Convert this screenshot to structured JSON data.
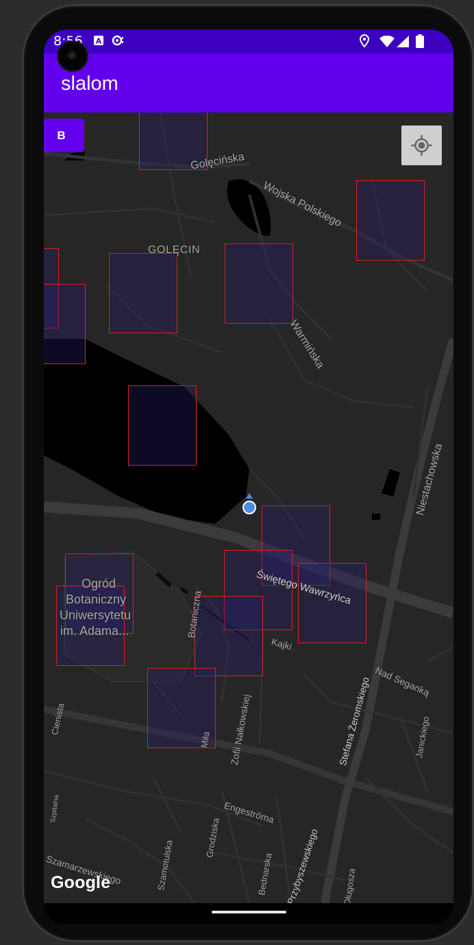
{
  "status_bar": {
    "time": "8:56",
    "left_icons": [
      "a-notification-icon",
      "sync-icon"
    ],
    "right_icons": [
      "location-icon",
      "wifi-icon",
      "signal-icon",
      "battery-icon"
    ]
  },
  "app_bar": {
    "title": "slalom"
  },
  "controls": {
    "b_button_label": "B"
  },
  "map": {
    "labels": {
      "golecinska": "Golęcińska",
      "wojska_polskiego": "Wojska Polskiego",
      "golecin": "GOLĘCIN",
      "warminska": "Warmińska",
      "niestachowska": "Niestachowska",
      "swietego_wawrzynca": "Świętego Wawrzyńca",
      "ogrod": "Ogród",
      "botaniczny": "Botaniczny",
      "uniwersytetu": "Uniwersytetu",
      "im_adama": "im. Adama...",
      "botaniczna": "Botaniczna",
      "kajki": "Kajki",
      "nad_seganka": "Nad Seganką",
      "stefana_zeromskiego": "Stefana Żeromskiego",
      "janickiego": "Janickiego",
      "cienista": "Cienista",
      "mila": "Miła",
      "zofii_nalkowskiej": "Zofii Nałkowskiej",
      "engestroma": "Engeströma",
      "szpitalna": "Szpitalna",
      "grodziska": "Grodziska",
      "szamotulska": "Szamotulska",
      "bednarska": "Bednarska",
      "przybyszewskiego": "Przybyszewskiego",
      "dlugosza": "Długosza",
      "szamarzewskiego": "Szamarzewskiego"
    },
    "attribution": "Google",
    "zone_count": 16,
    "zone_border_color": "#e02020",
    "accent_color": "#6200ee"
  }
}
